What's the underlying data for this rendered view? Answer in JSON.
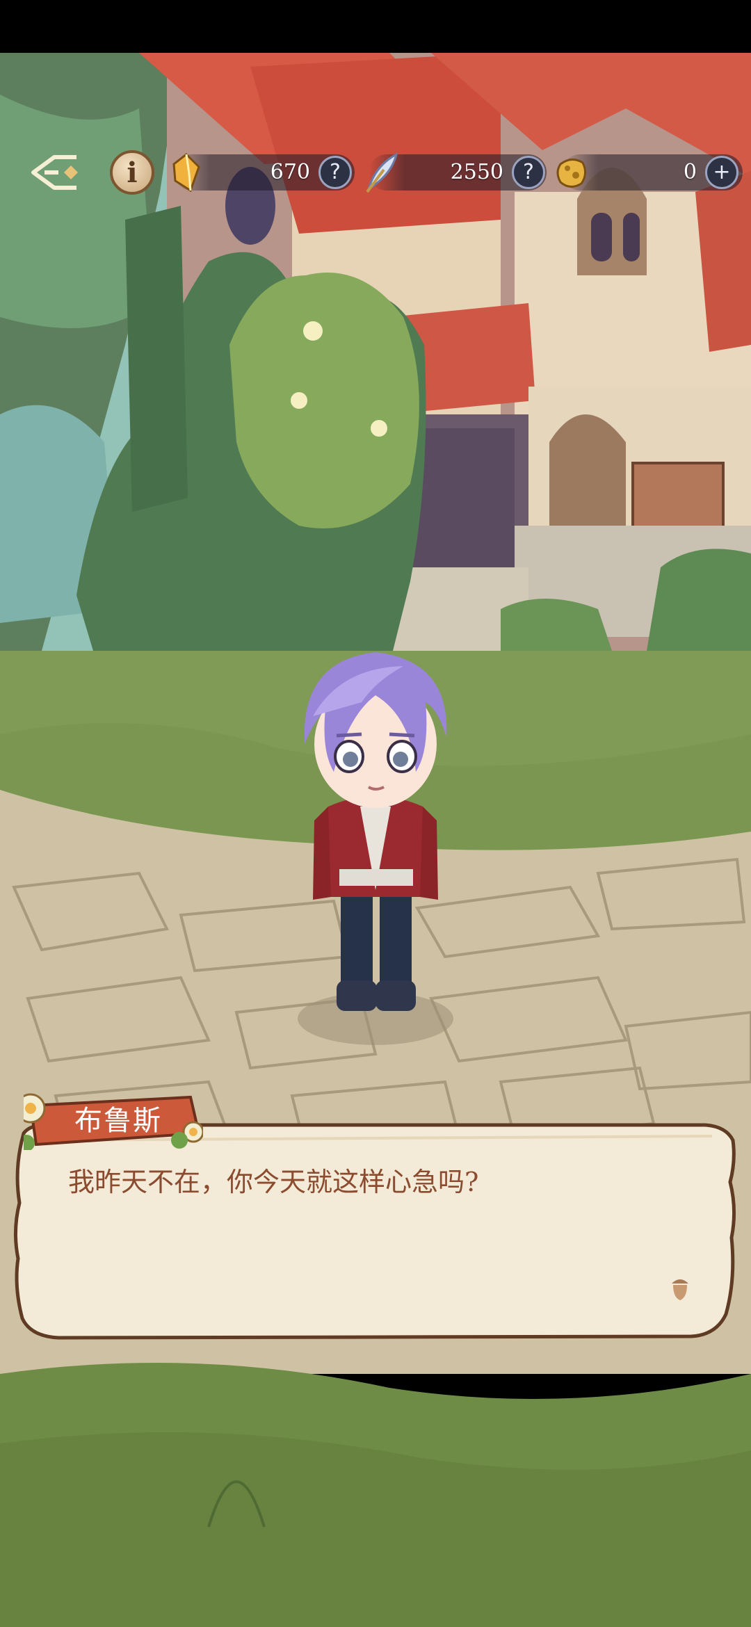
{
  "header": {
    "back_icon": "back-arrow-icon",
    "info_icon": "info-icon",
    "info_label": "i"
  },
  "resources": [
    {
      "icon": "gem-icon",
      "value": "670",
      "action": "?",
      "action_icon": "help-icon"
    },
    {
      "icon": "feather-icon",
      "value": "2550",
      "action": "?",
      "action_icon": "help-icon"
    },
    {
      "icon": "gold-ore-icon",
      "value": "0",
      "action": "+",
      "action_icon": "add-icon"
    }
  ],
  "dialog": {
    "speaker": "布鲁斯",
    "text": "我昨天不在，你今天就这样心急吗?",
    "next_icon": "acorn-icon"
  },
  "colors": {
    "grass": "#7f9b55",
    "stone": "#cfc2a4",
    "roof": "#d65a45",
    "dialog_bg": "#f4ead8",
    "name_tag": "#cc5a3a",
    "dialog_text": "#8a4b2f"
  }
}
